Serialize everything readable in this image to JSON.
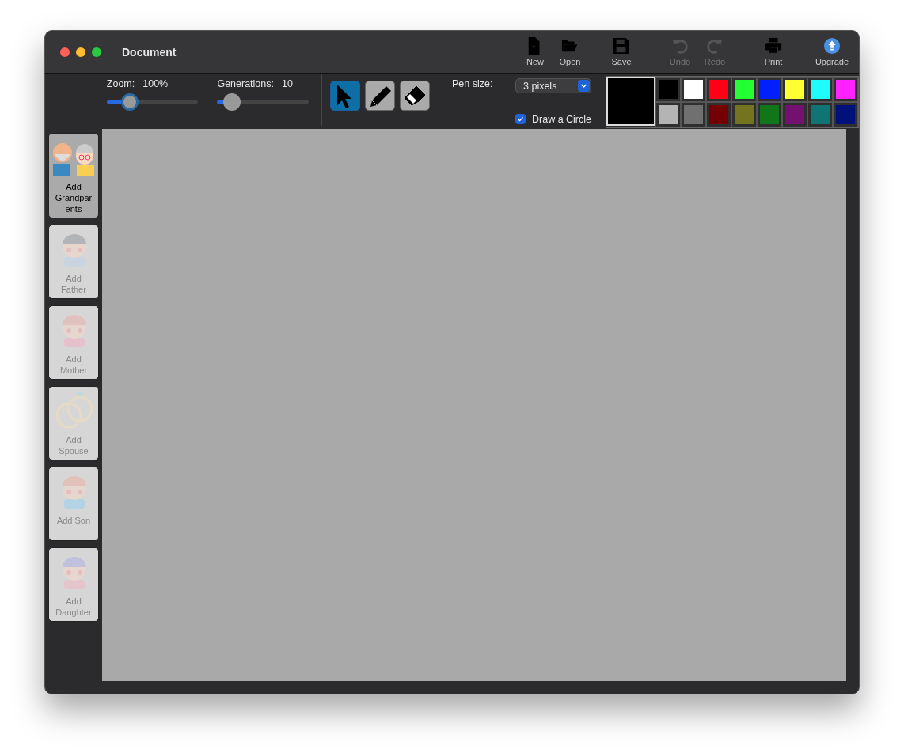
{
  "window": {
    "title": "Document"
  },
  "toolbar_buttons": [
    {
      "kind": "new",
      "label": "New",
      "disabled": false
    },
    {
      "kind": "open",
      "label": "Open",
      "disabled": false
    },
    {
      "kind": "save",
      "label": "Save",
      "disabled": false
    },
    {
      "kind": "undo",
      "label": "Undo",
      "disabled": true
    },
    {
      "kind": "redo",
      "label": "Redo",
      "disabled": true
    },
    {
      "kind": "print",
      "label": "Print",
      "disabled": false
    },
    {
      "kind": "upgrade",
      "label": "Upgrade",
      "disabled": false
    }
  ],
  "sliders": [
    {
      "label": "Zoom:",
      "reading": "100%",
      "level": 0.25,
      "focused": true
    },
    {
      "label": "Generations:",
      "reading": "10",
      "level": 0.16,
      "focused": false
    }
  ],
  "tools": [
    {
      "kind": "pointer",
      "selected": true
    },
    {
      "kind": "pencil",
      "selected": false
    },
    {
      "kind": "eraser",
      "selected": false
    }
  ],
  "pen_size": {
    "label": "Pen size:",
    "value": "3 pixels"
  },
  "draw_circle": {
    "label": "Draw a Circle",
    "checked": true
  },
  "current_color": {
    "color": "#000000"
  },
  "palette": [
    {
      "color": "#000000"
    },
    {
      "color": "#ffffff"
    },
    {
      "color": "#ff0016"
    },
    {
      "color": "#22ff33"
    },
    {
      "color": "#0020ff"
    },
    {
      "color": "#ffff33"
    },
    {
      "color": "#1ffcff"
    },
    {
      "color": "#ff22ff"
    },
    {
      "color": "#b4b4b4"
    },
    {
      "color": "#707070"
    },
    {
      "color": "#720005"
    },
    {
      "color": "#737320"
    },
    {
      "color": "#117519"
    },
    {
      "color": "#741170"
    },
    {
      "color": "#117474"
    },
    {
      "color": "#00117a"
    }
  ],
  "sidebar": {
    "items": [
      {
        "kind": "grandparents",
        "label": "Add Grandparents",
        "disabled": false
      },
      {
        "kind": "father",
        "label": "Add Father",
        "disabled": true
      },
      {
        "kind": "mother",
        "label": "Add Mother",
        "disabled": true
      },
      {
        "kind": "spouse",
        "label": "Add Spouse",
        "disabled": true
      },
      {
        "kind": "son",
        "label": "Add Son",
        "disabled": true
      },
      {
        "kind": "daughter",
        "label": "Add Daughter",
        "disabled": true
      }
    ]
  }
}
